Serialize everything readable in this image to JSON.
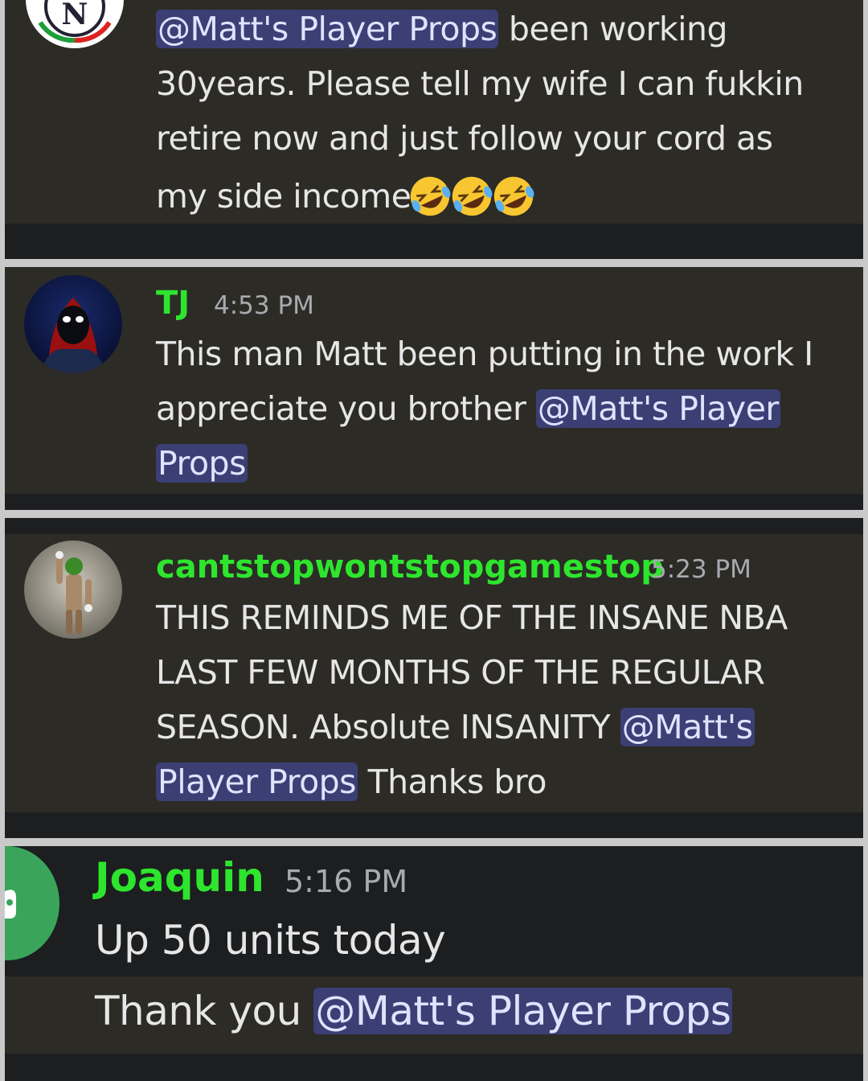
{
  "mention": "@Matt's Player Props",
  "messages": [
    {
      "text_lines": [
        "been working",
        "30years. Please tell my wife I can fukkin",
        "retire now and just follow your cord as",
        "my side income"
      ],
      "emoji": [
        "rolling-on-floor-laughing",
        "rolling-on-floor-laughing",
        "rolling-on-floor-laughing"
      ]
    },
    {
      "author": "TJ",
      "time": "4:53 PM",
      "text_lines": [
        "This man Matt been putting in the work I",
        "appreciate you brother",
        "@Matt's Player",
        "Props"
      ]
    },
    {
      "author": "cantstopwontstopgamestop",
      "time": "5:23 PM",
      "text_lines": [
        "THIS REMINDS ME OF THE INSANE NBA",
        "LAST FEW MONTHS OF THE REGULAR",
        "SEASON. Absolute INSANITY",
        "@Matt's",
        "Player Props",
        "Thanks bro"
      ]
    },
    {
      "author": "Joaquin",
      "time": "5:16 PM",
      "text_lines": [
        "Up 50 units today",
        "Thank you"
      ]
    }
  ]
}
